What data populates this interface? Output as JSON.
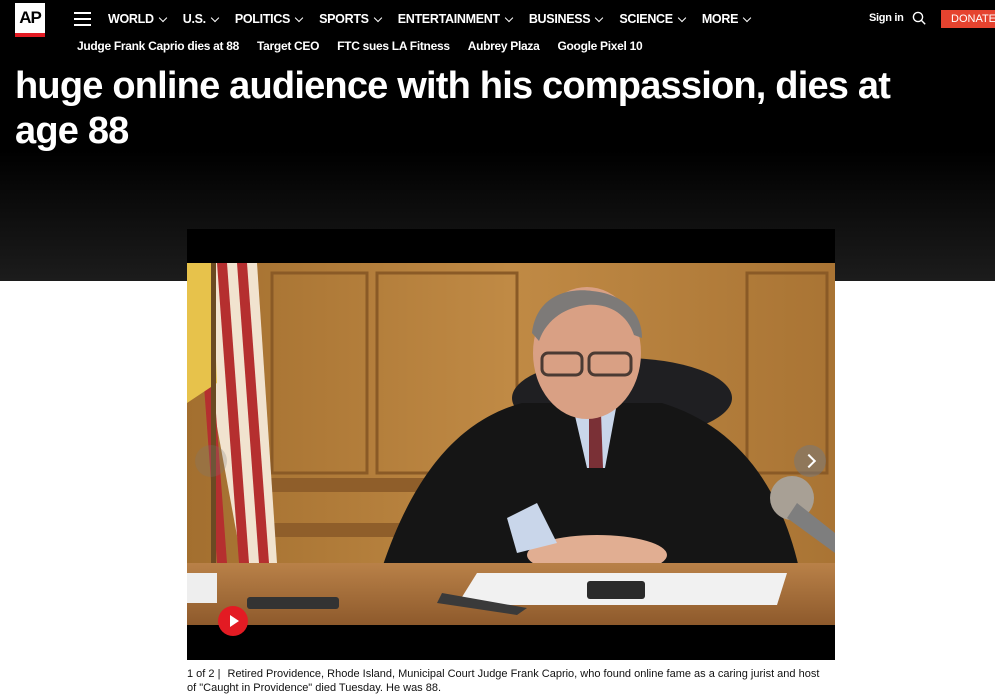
{
  "brand": {
    "logo_text": "AP",
    "accent": "#e31b23"
  },
  "nav": {
    "items": [
      {
        "label": "WORLD",
        "has_dropdown": true
      },
      {
        "label": "U.S.",
        "has_dropdown": true
      },
      {
        "label": "POLITICS",
        "has_dropdown": true
      },
      {
        "label": "SPORTS",
        "has_dropdown": true
      },
      {
        "label": "ENTERTAINMENT",
        "has_dropdown": true
      },
      {
        "label": "BUSINESS",
        "has_dropdown": true
      },
      {
        "label": "SCIENCE",
        "has_dropdown": true
      },
      {
        "label": "MORE",
        "has_dropdown": true
      }
    ],
    "signin": "Sign in",
    "donate": "DONATE",
    "donate_color": "#e5432f",
    "icons": {
      "menu": "hamburger-icon",
      "search": "search-icon"
    }
  },
  "trending": [
    "Judge Frank Caprio dies at 88",
    "Target CEO",
    "FTC sues LA Fitness",
    "Aubrey Plaza",
    "Google Pixel 10"
  ],
  "article": {
    "headline": "huge online audience with his compassion, dies at age 88"
  },
  "gallery": {
    "counter": "1 of 2 |",
    "caption": "Retired Providence, Rhode Island, Municipal Court Judge Frank Caprio, who found online fame as a caring jurist and host of \"Caught in Providence\" died Tuesday. He was 88.",
    "icons": {
      "next": "chevron-right-icon",
      "play": "play-icon"
    }
  }
}
